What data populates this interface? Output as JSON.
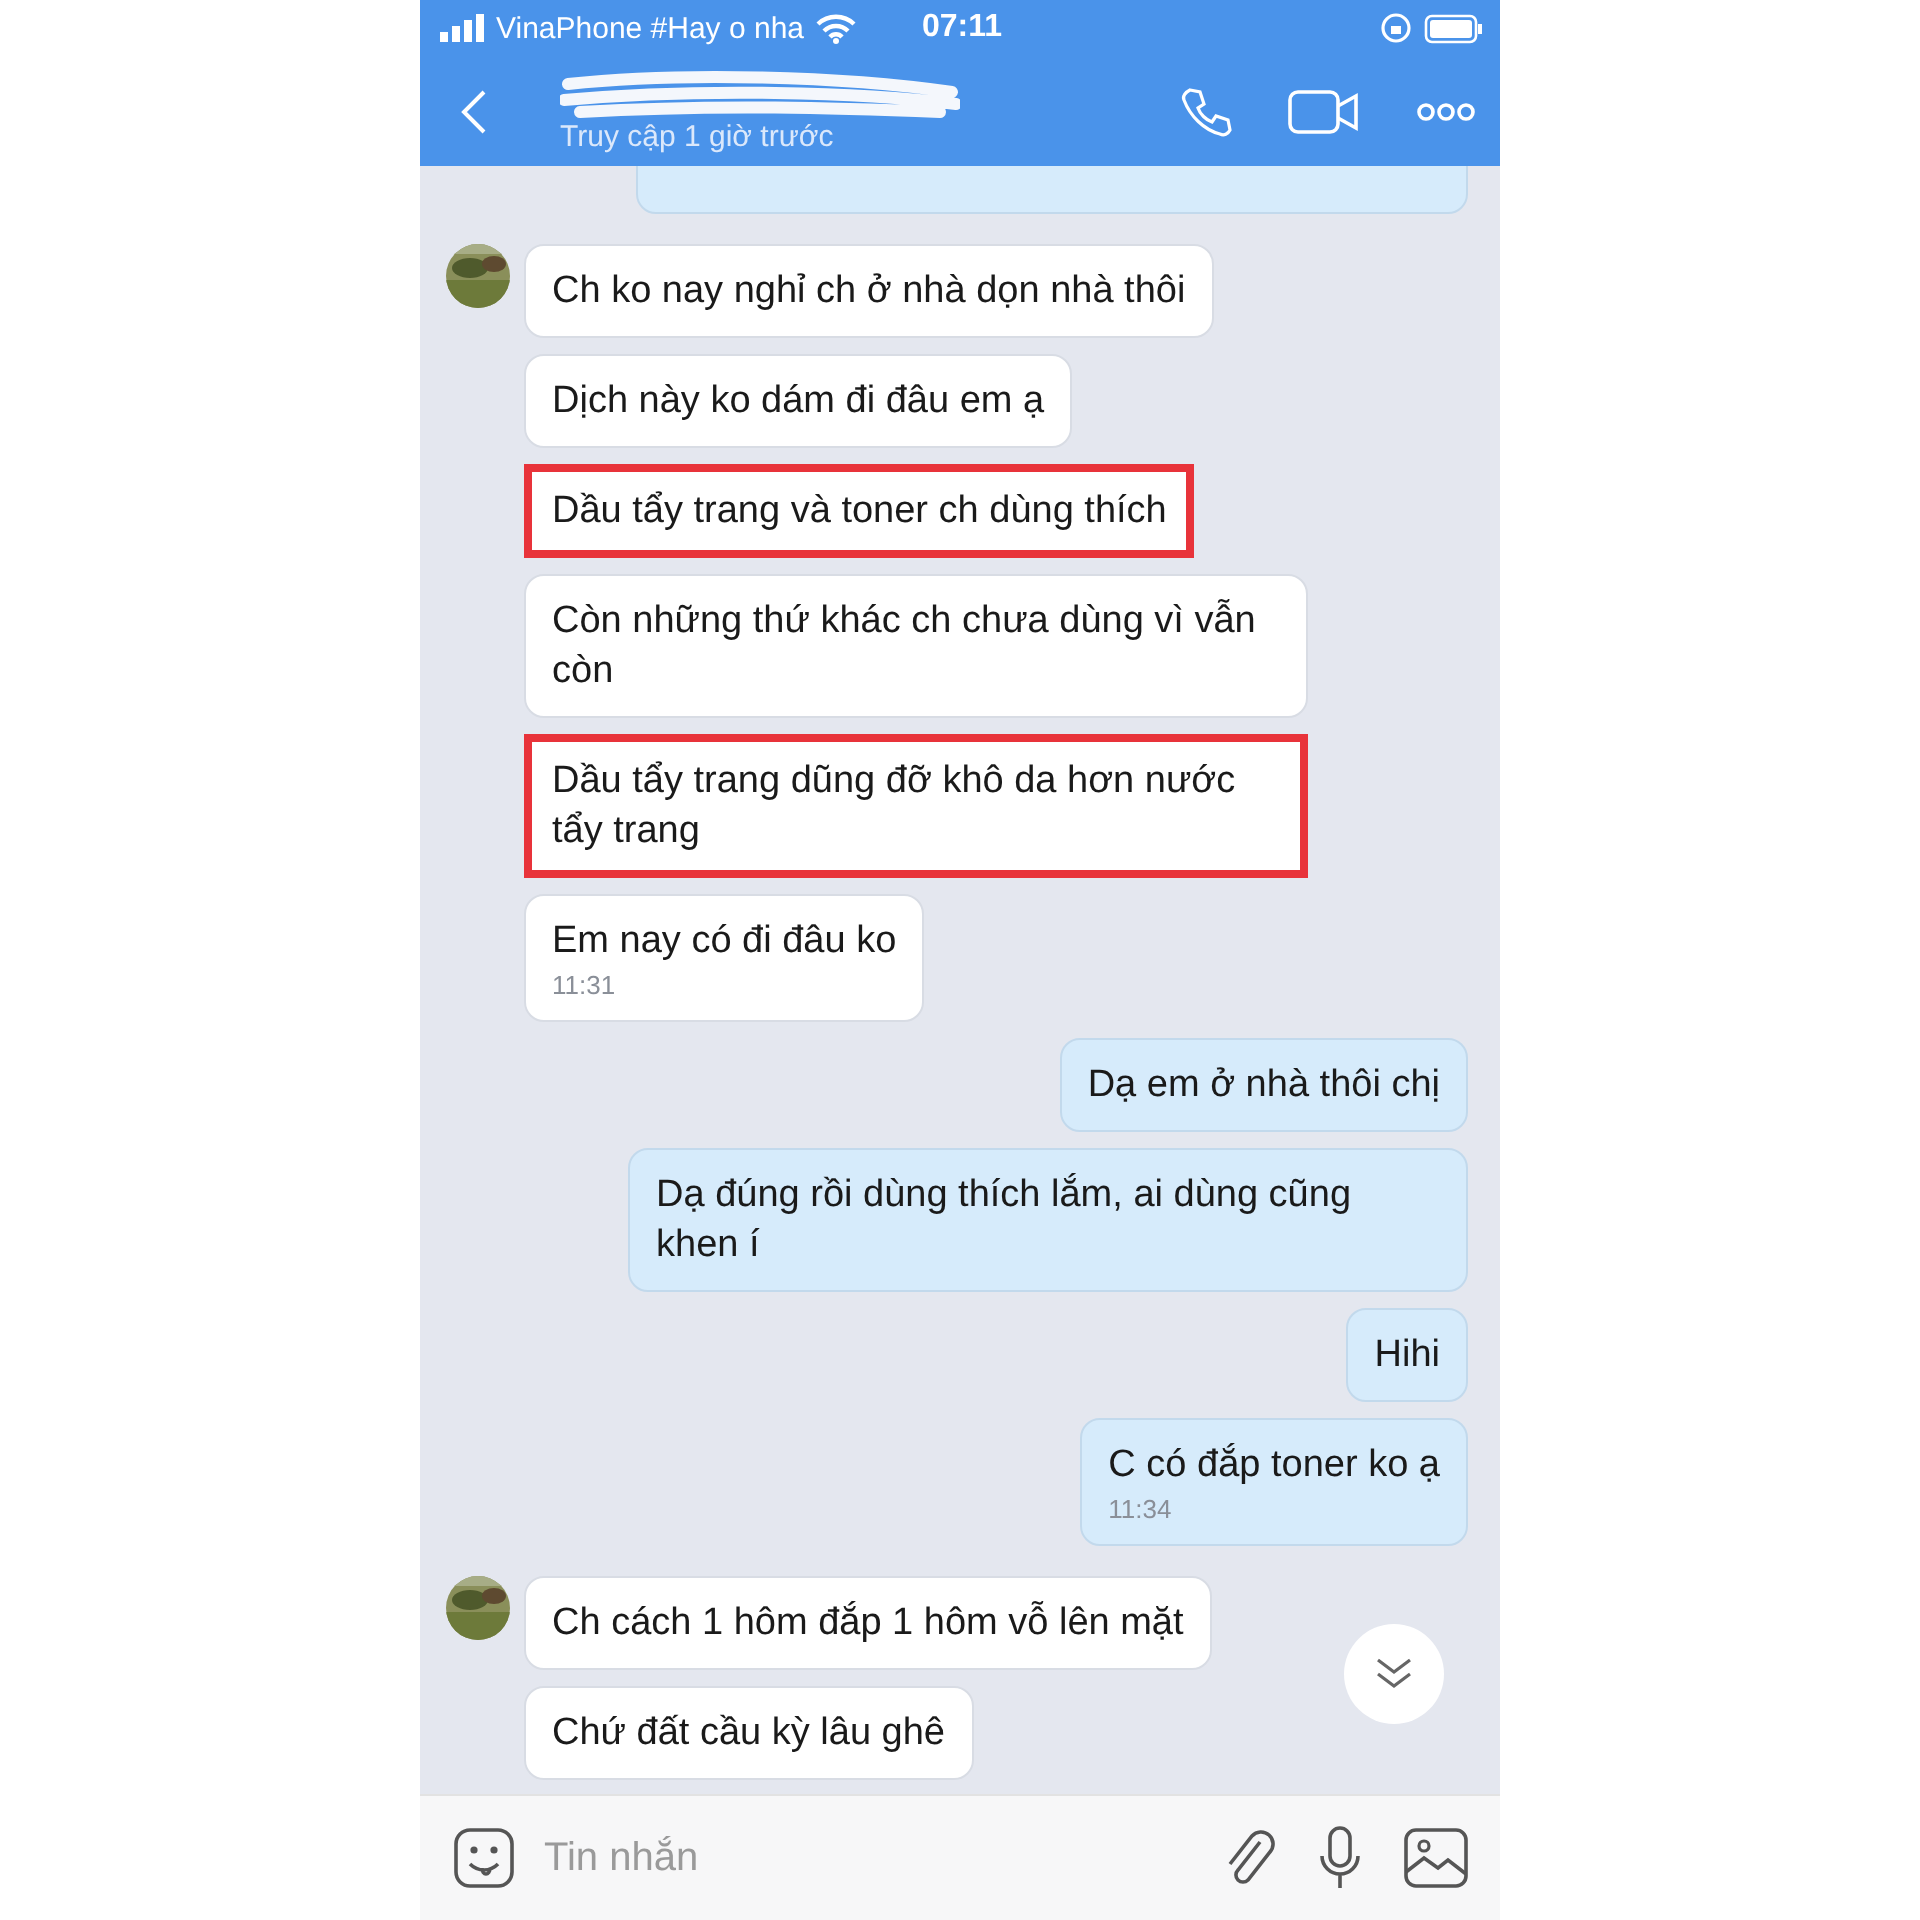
{
  "status_bar": {
    "carrier": "VinaPhone #Hay o nha",
    "time": "07:11"
  },
  "header": {
    "status": "Truy cập 1 giờ trước"
  },
  "messages": [
    {
      "kind": "received",
      "avatar": true,
      "text": "Ch ko nay nghỉ ch ở nhà dọn nhà thôi",
      "highlighted": false
    },
    {
      "kind": "received",
      "avatar": false,
      "text": "Dịch này ko dám đi đâu em ạ",
      "highlighted": false
    },
    {
      "kind": "received",
      "avatar": false,
      "text": "Dầu tẩy trang và toner ch dùng thích",
      "highlighted": true
    },
    {
      "kind": "received",
      "avatar": false,
      "text": "Còn những thứ khác ch chưa dùng vì vẫn còn",
      "highlighted": false
    },
    {
      "kind": "received",
      "avatar": false,
      "text": "Dầu tẩy trang dũng đỡ khô da hơn nước tẩy trang",
      "highlighted": true
    },
    {
      "kind": "received",
      "avatar": false,
      "text": "Em nay có đi đâu ko",
      "time": "11:31",
      "highlighted": false
    },
    {
      "kind": "sent",
      "text": "Dạ em ở nhà thôi chị",
      "highlighted": false
    },
    {
      "kind": "sent",
      "text": "Dạ đúng rồi dùng thích lắm, ai dùng cũng khen í",
      "highlighted": false
    },
    {
      "kind": "sent",
      "text": "Hihi",
      "highlighted": false
    },
    {
      "kind": "sent",
      "text": "C có đắp toner ko ạ",
      "time": "11:34",
      "highlighted": false
    },
    {
      "kind": "received",
      "avatar": true,
      "text": "Ch cách 1 hôm đắp 1 hôm vỗ lên mặt",
      "highlighted": false
    },
    {
      "kind": "received",
      "avatar": false,
      "text": "Chứ đất cầu kỳ lâu ghê",
      "highlighted": false
    }
  ],
  "composer": {
    "placeholder": "Tin nhắn"
  }
}
